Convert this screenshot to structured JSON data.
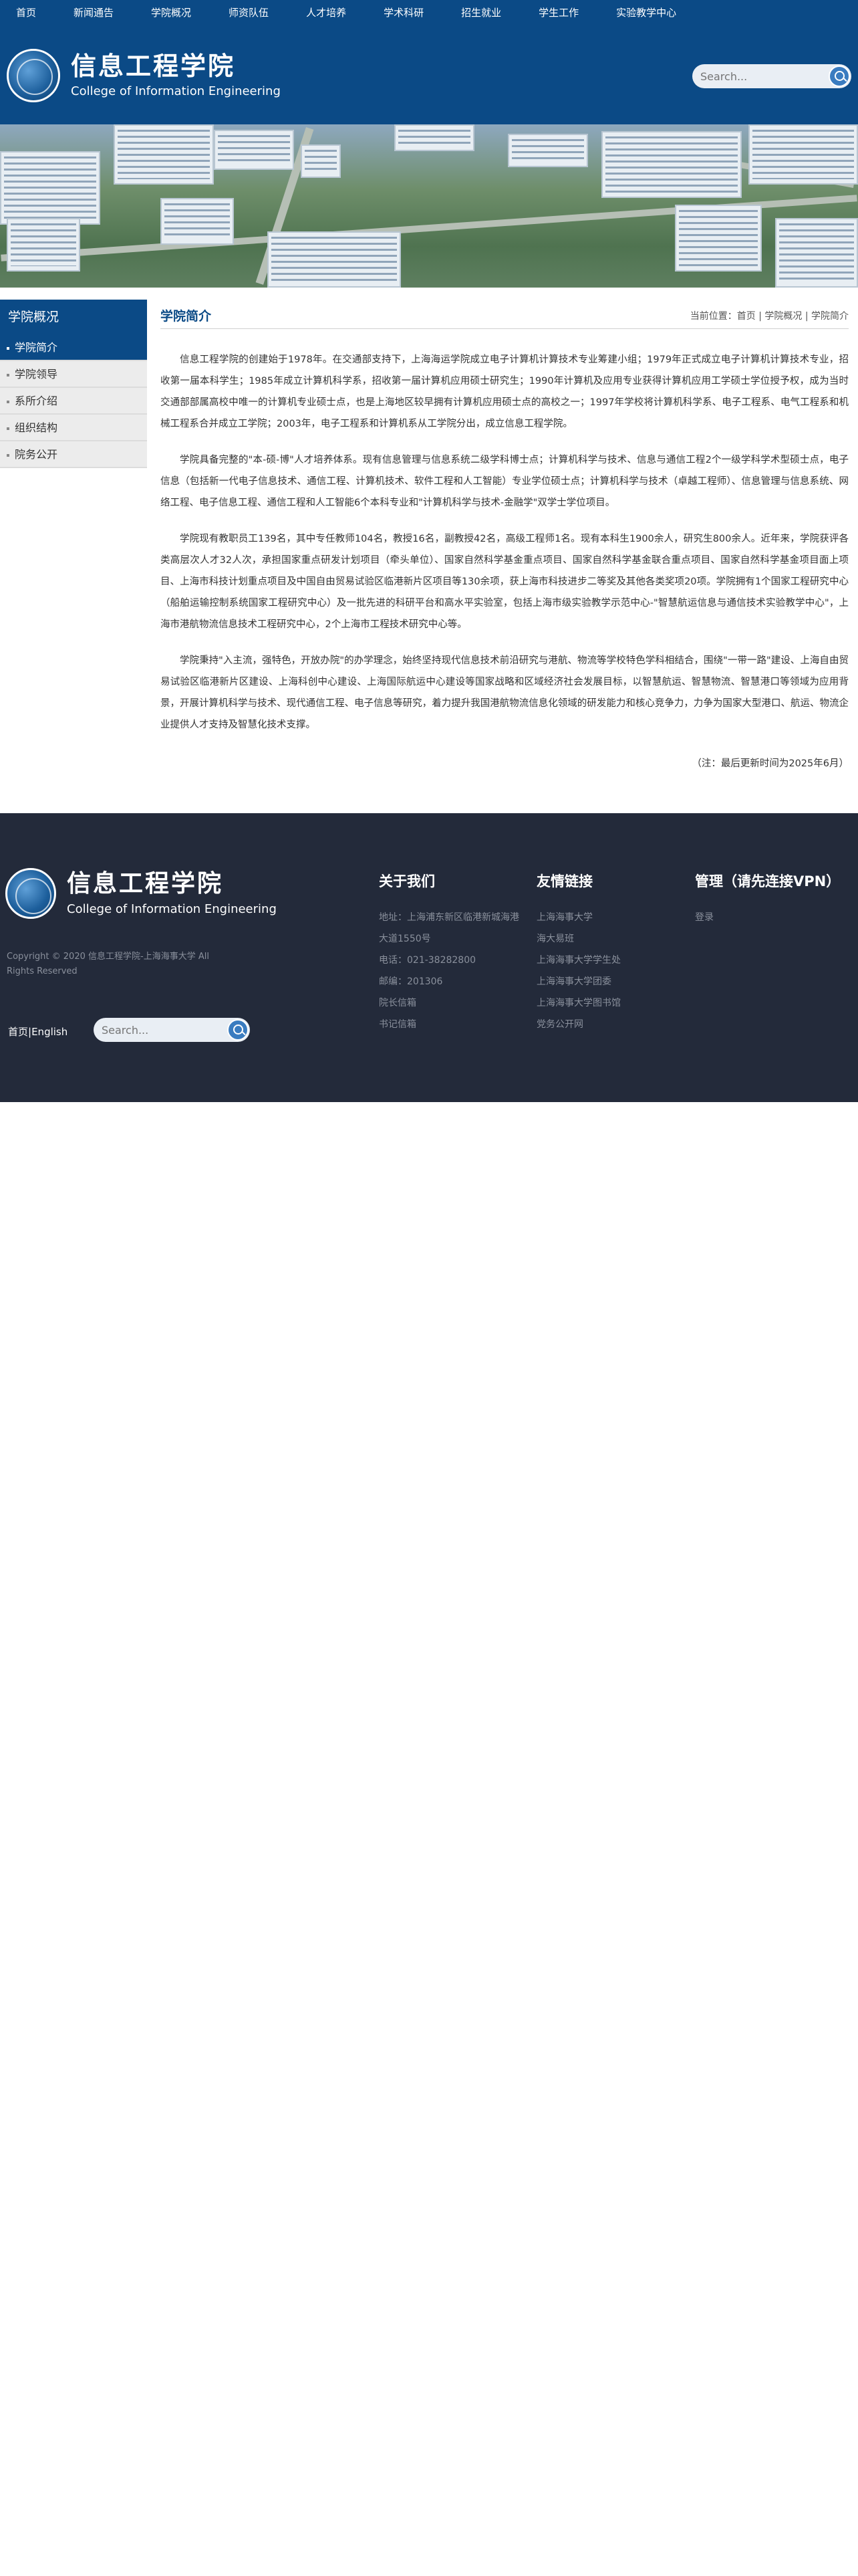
{
  "nav": [
    "首页",
    "新闻通告",
    "学院概况",
    "师资队伍",
    "人才培养",
    "学术科研",
    "招生就业",
    "学生工作",
    "实验教学中心"
  ],
  "logo": {
    "cn": "信息工程学院",
    "en": "College of Information Engineering"
  },
  "search": {
    "placeholder": "Search..."
  },
  "sidebar": {
    "title": "学院概况",
    "items": [
      {
        "label": "学院简介",
        "active": true
      },
      {
        "label": "学院领导",
        "active": false
      },
      {
        "label": "系所介绍",
        "active": false
      },
      {
        "label": "组织结构",
        "active": false
      },
      {
        "label": "院务公开",
        "active": false
      }
    ]
  },
  "content": {
    "title": "学院简介",
    "breadcrumb": {
      "prefix": "当前位置：",
      "items": [
        "首页",
        "学院概况",
        "学院简介"
      ],
      "separator": "|"
    },
    "paragraphs": [
      "信息工程学院的创建始于1978年。在交通部支持下，上海海运学院成立电子计算机计算技术专业筹建小组；1979年正式成立电子计算机计算技术专业，招收第一届本科学生；1985年成立计算机科学系，招收第一届计算机应用硕士研究生；1990年计算机及应用专业获得计算机应用工学硕士学位授予权，成为当时交通部部属高校中唯一的计算机专业硕士点，也是上海地区较早拥有计算机应用硕士点的高校之一；1997年学校将计算机科学系、电子工程系、电气工程系和机械工程系合并成立工学院；2003年，电子工程系和计算机系从工学院分出，成立信息工程学院。",
      "学院具备完整的\"本-硕-博\"人才培养体系。现有信息管理与信息系统二级学科博士点；计算机科学与技术、信息与通信工程2个一级学科学术型硕士点，电子信息（包括新一代电子信息技术、通信工程、计算机技术、软件工程和人工智能）专业学位硕士点；计算机科学与技术（卓越工程师）、信息管理与信息系统、网络工程、电子信息工程、通信工程和人工智能6个本科专业和\"计算机科学与技术-金融学\"双学士学位项目。",
      "学院现有教职员工139名，其中专任教师104名，教授16名，副教授42名，高级工程师1名。现有本科生1900余人，研究生800余人。近年来，学院获评各类高层次人才32人次，承担国家重点研发计划项目（牵头单位）、国家自然科学基金重点项目、国家自然科学基金联合重点项目、国家自然科学基金项目面上项目、上海市科技计划重点项目及中国自由贸易试验区临港新片区项目等130余项，获上海市科技进步二等奖及其他各类奖项20项。学院拥有1个国家工程研究中心（船舶运输控制系统国家工程研究中心）及一批先进的科研平台和高水平实验室，包括上海市级实验教学示范中心-\"智慧航运信息与通信技术实验教学中心\"，上海市港航物流信息技术工程研究中心，2个上海市工程技术研究中心等。",
      "学院秉持\"入主流，强特色，开放办院\"的办学理念，始终坚持现代信息技术前沿研究与港航、物流等学校特色学科相结合，围绕\"一带一路\"建设、上海自由贸易试验区临港新片区建设、上海科创中心建设、上海国际航运中心建设等国家战略和区域经济社会发展目标，以智慧航运、智慧物流、智慧港口等领域为应用背景，开展计算机科学与技术、现代通信工程、电子信息等研究，着力提升我国港航物流信息化领域的研发能力和核心竞争力，力争为国家大型港口、航运、物流企业提供人才支持及智慧化技术支撑。"
    ],
    "note": "（注：最后更新时间为2025年6月）"
  },
  "footer": {
    "copyright": "Copyright © 2020 信息工程学院-上海海事大学 All Rights Reserved",
    "lang": {
      "cn": "首页",
      "sep": "|",
      "en": "English"
    },
    "about": {
      "title": "关于我们",
      "lines": [
        "地址：上海浦东新区临港新城海港",
        "大道1550号",
        "电话：021-38282800",
        "邮编：201306",
        "院长信箱",
        "书记信箱"
      ]
    },
    "links": {
      "title": "友情链接",
      "items": [
        "上海海事大学",
        "海大易班",
        "上海海事大学学生处",
        "上海海事大学团委",
        "上海海事大学图书馆",
        "党务公开网"
      ]
    },
    "admin": {
      "title": "管理（请先连接VPN）",
      "items": [
        "登录"
      ]
    }
  },
  "colors": {
    "primary": "#0b4a86",
    "footer": "#232a3a",
    "footer_text": "#8a909c"
  }
}
